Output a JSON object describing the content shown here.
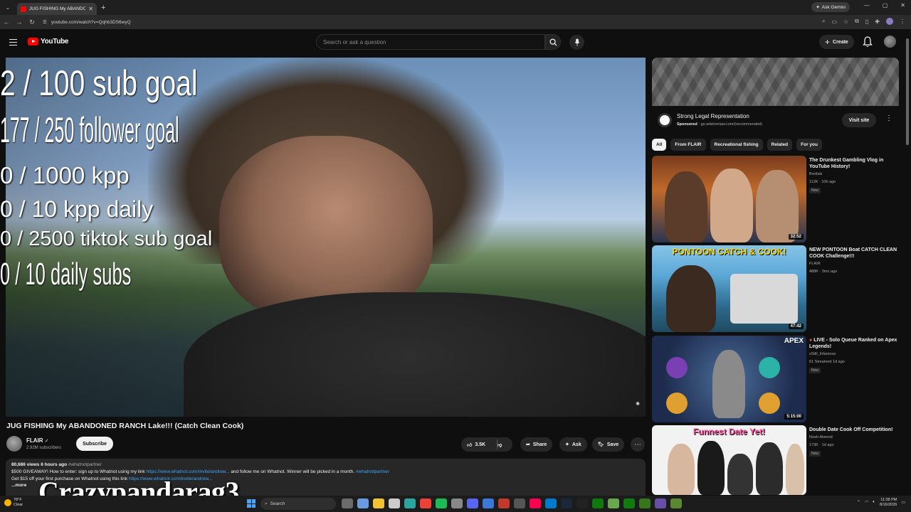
{
  "browser": {
    "tab_title": "JUG FISHING My ABANDONED RANCH Lake!!! (Catch Clean Cook)",
    "url": "youtube.com/watch?v=Qqhb3DS6wyQ",
    "gemini_label": "Ask Gemini"
  },
  "header": {
    "logo_text": "YouTube",
    "search_placeholder": "Search or ask a question",
    "create_label": "Create"
  },
  "overlay": {
    "goals": [
      "2  / 100 sub goal",
      "177 / 250 follower goal",
      "0 / 1000 kpp",
      "0 / 10 kpp daily",
      "0 / 2500 tiktok sub goal",
      "0 / 10 daily subs"
    ],
    "name": "Crazypandarag3"
  },
  "video": {
    "title": "JUG FISHING My ABANDONED RANCH Lake!!! (Catch Clean Cook)",
    "channel": "FLAIR",
    "subscribers": "2.92M subscribers",
    "subscribe_label": "Subscribe",
    "likes": "3.5K",
    "share_label": "Share",
    "ask_label": "Ask",
    "save_label": "Save",
    "views_time": "80,686 views  6 hours ago",
    "hashtag": "#whatnotpartner",
    "desc_line1_a": "$500 GIVEAWAY! How to enter: sign up to Whatnot using my link",
    "desc_link1": "https://www.whatnot.com/invite/andrew...",
    "desc_line1_b": "and follow me on Whatnot. Winner will be picked in a month.",
    "desc_tag2": "#whatnotpartner",
    "desc_line2_a": "Get $15 off your first purchase on Whatnot using this link",
    "desc_link2": "https://www.whatnot.com/invite/andrew...",
    "more_label": "...more"
  },
  "ad": {
    "title": "Strong Legal Representation",
    "sponsored": "Sponsored",
    "domain": "go.wilshirelaw.com/(recommended)",
    "visit_label": "Visit site"
  },
  "chips": [
    "All",
    "From FLAIR",
    "Recreational fishing",
    "Related",
    "For you"
  ],
  "recommendations": [
    {
      "title": "The Drunkest Gambling Vlog in YouTube History!",
      "channel": "Brettski",
      "meta": "112K · 10h ago",
      "badge": "New",
      "duration": "32:52",
      "thumb_text": ""
    },
    {
      "title": "NEW PONTOON Boat CATCH CLEAN COOK Challenge!!!",
      "channel": "FLAIR",
      "meta": "488K · 3mo ago",
      "badge": "",
      "duration": "47:42",
      "thumb_text": "PONTOON CATCH & COOK!"
    },
    {
      "title": "LIVE - Solo Queue Ranked on Apex Legends!",
      "channel": "xStill_Infamous",
      "meta": "61 Streamed 1d ago",
      "badge": "New",
      "duration": "5:15:00",
      "thumb_text": "APEX"
    },
    {
      "title": "Double Date Cook Off Competition!",
      "channel": "Noah Atwood",
      "meta": "173K · 1d ago",
      "badge": "New",
      "duration": "",
      "thumb_text": "Funnest Date Yet!"
    }
  ],
  "taskbar": {
    "weather_temp": "78°F",
    "weather_desc": "Clear",
    "search_label": "Search",
    "time": "11:38 PM",
    "date": "8/16/2026"
  }
}
